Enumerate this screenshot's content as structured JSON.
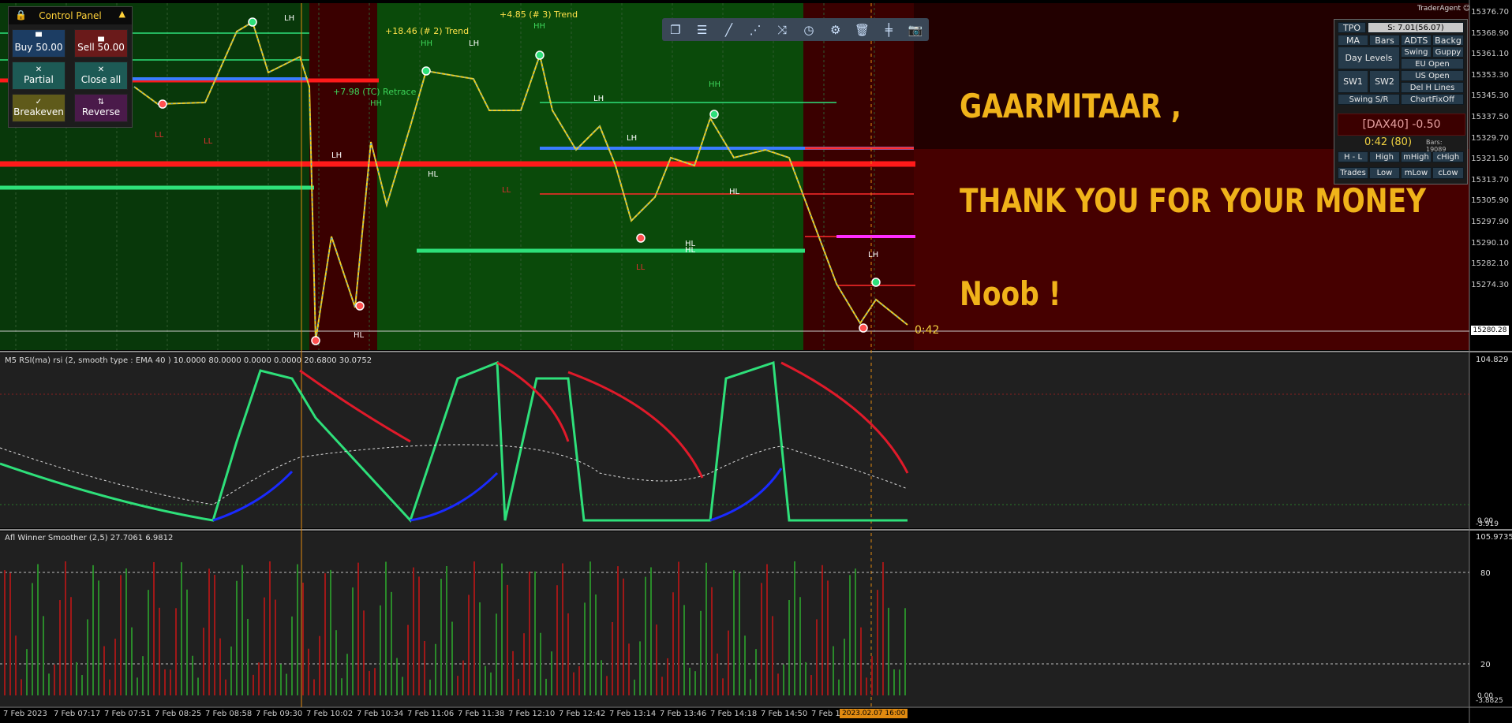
{
  "control_panel": {
    "title": "Control Panel",
    "buttons": {
      "buy": "Buy 50.00",
      "sell": "Sell 50.00",
      "partial": "Partial",
      "close_all": "Close all",
      "breakeven": "Breakeven",
      "reverse": "Reverse"
    },
    "icons": [
      "lock-icon",
      "chevron-up-icon",
      "arrow-up-icon",
      "arrow-down-icon",
      "x-icon",
      "checkmark-icon",
      "swap-icon"
    ]
  },
  "toolbar": {
    "icons": [
      "windows-icon",
      "menu-icon",
      "line-icon",
      "dashed-line-icon",
      "shuffle-icon",
      "clock-icon",
      "settings-icon",
      "trash-icon",
      "separator-icon",
      "camera-icon"
    ]
  },
  "tpo_panel": {
    "tpo_label": "TPO",
    "s_value": "S: 7.01(56.07)",
    "buttons": {
      "ma": "MA",
      "bars": "Bars",
      "adts": "ADTS",
      "backg": "Backg",
      "day_levels": "Day Levels",
      "swing": "Swing",
      "guppy": "Guppy",
      "eu_open": "EU Open",
      "us_open": "US Open",
      "del_h_lines": "Del H Lines",
      "sw1": "SW1",
      "sw2": "SW2",
      "swing_sr": "Swing S/R",
      "chartfixoff": "ChartFixOff",
      "h_l": "H - L",
      "high": "High",
      "mhigh": "mHigh",
      "chigh": "cHigh",
      "trades": "Trades",
      "low": "Low",
      "mlow": "mLow",
      "clow": "cLow"
    },
    "dax_box": "[DAX40] -0.50",
    "timer": "0:42 (80)",
    "bars_count": "Bars: 19089"
  },
  "header": {
    "trader_agent": "TraderAgent"
  },
  "overlay": {
    "line1": "GAARMITAAR ,",
    "line2": "THANK YOU FOR YOUR MONEY",
    "line3": "Noob !"
  },
  "annotations": {
    "trend2": "+18.46 (# 2) Trend",
    "trend3": "+4.85 (# 3) Trend",
    "retrace": "+7.98 (TC) Retrace",
    "hh": "HH",
    "lh": "LH",
    "hl": "HL",
    "ll": "LL",
    "countdown": "0:42",
    "current_price": "15280.28"
  },
  "price_axis": [
    "15376.70",
    "15368.90",
    "15361.10",
    "15353.30",
    "15345.30",
    "15337.50",
    "15329.70",
    "15321.50",
    "15313.70",
    "15305.90",
    "15297.90",
    "15290.10",
    "15282.10",
    "15274.30"
  ],
  "rsi_pane": {
    "label": "M5 RSI(ma) rsi (2, smooth type : EMA  40 ) 10.0000 80.0000 0.0000 0.0000 20.6800 30.0752",
    "top_value": "104.829",
    "bottom_value": "-3.919",
    "zero": "0.00"
  },
  "afl_pane": {
    "label": "Afl Winner Smoother (2,5) 27.7061 6.9812",
    "top_value": "105.9735",
    "level_80": "80",
    "level_20": "20",
    "zero": "0.00",
    "bottom_value": "-3.8825"
  },
  "time_axis": [
    "7 Feb 2023",
    "7 Feb 07:17",
    "7 Feb 07:51",
    "7 Feb 08:25",
    "7 Feb 08:58",
    "7 Feb 09:30",
    "7 Feb 10:02",
    "7 Feb 10:34",
    "7 Feb 11:06",
    "7 Feb 11:38",
    "7 Feb 12:10",
    "7 Feb 12:42",
    "7 Feb 13:14",
    "7 Feb 13:46",
    "7 Feb 14:18",
    "7 Feb 14:50",
    "7 Feb 15"
  ],
  "time_highlight": "2023.02.07 16:00",
  "colors": {
    "green_zone": "#0a4d0a",
    "red_zone": "#3a0000",
    "overlay_text": "#f0b31a",
    "rsi_up": "#2ee07a",
    "rsi_down": "#e01a2a"
  }
}
